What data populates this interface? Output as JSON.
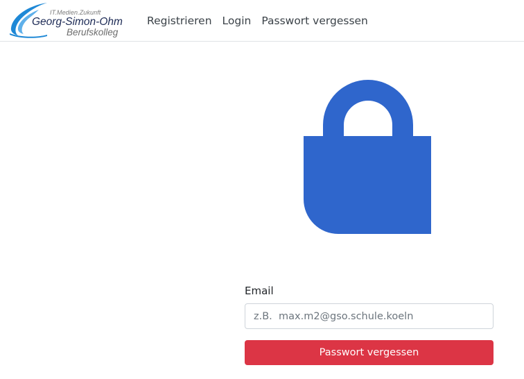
{
  "brand": {
    "tagline": "IT.Medien.Zukunft",
    "school_name": "Georg-Simon-Ohm",
    "department": "Berufskolleg",
    "accent_color": "#1e88d6"
  },
  "nav": {
    "items": [
      {
        "label": "Registrieren"
      },
      {
        "label": "Login"
      },
      {
        "label": "Passwort vergessen"
      }
    ]
  },
  "hero": {
    "icon": "lock-icon",
    "color": "#2f66cc"
  },
  "form": {
    "email_label": "Email",
    "email_placeholder": "z.B.  max.m2@gso.schule.koeln",
    "email_value": "",
    "submit_label": "Passwort vergessen",
    "submit_color": "#dc3545"
  }
}
